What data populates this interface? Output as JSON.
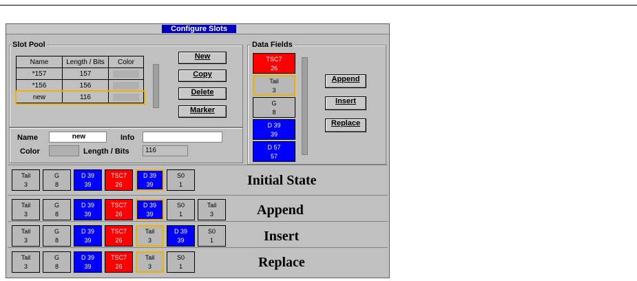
{
  "window": {
    "title": "Configure Slots"
  },
  "slot_pool": {
    "legend": "Slot Pool",
    "columns": [
      "Name",
      "Length / Bits",
      "Color"
    ],
    "rows": [
      {
        "name": "*157",
        "length": "157"
      },
      {
        "name": "*156",
        "length": "156"
      },
      {
        "name": "new",
        "length": "116"
      }
    ],
    "buttons": {
      "new": "New",
      "copy": "Copy",
      "delete": "Delete",
      "marker": "Marker"
    }
  },
  "editor": {
    "name_label": "Name",
    "name_value": "new",
    "info_label": "Info",
    "info_value": "",
    "color_label": "Color",
    "length_label": "Length / Bits",
    "length_value": "116"
  },
  "data_fields": {
    "legend": "Data Fields",
    "items": [
      {
        "top": "TSC7",
        "bottom": "26",
        "color": "red"
      },
      {
        "top": "Tail",
        "bottom": "3",
        "color": "gray",
        "selected": true
      },
      {
        "top": "G",
        "bottom": "8",
        "color": "gray"
      },
      {
        "top": "D 39",
        "bottom": "39",
        "color": "blue"
      },
      {
        "top": "D 57",
        "bottom": "57",
        "color": "blue"
      }
    ],
    "buttons": {
      "append": "Append",
      "insert": "Insert",
      "replace": "Replace"
    }
  },
  "sequences": [
    {
      "label": "Initial State",
      "slots": [
        {
          "top": "Tail",
          "bottom": "3",
          "color": "gray"
        },
        {
          "top": "G",
          "bottom": "8",
          "color": "gray"
        },
        {
          "top": "D 39",
          "bottom": "39",
          "color": "blue"
        },
        {
          "top": "TSC7",
          "bottom": "26",
          "color": "red"
        },
        {
          "top": "D 39",
          "bottom": "39",
          "color": "blue",
          "selected": true
        },
        {
          "top": "S0",
          "bottom": "1",
          "color": "gray"
        }
      ]
    },
    {
      "label": "Append",
      "slots": [
        {
          "top": "Tail",
          "bottom": "3",
          "color": "gray"
        },
        {
          "top": "G",
          "bottom": "8",
          "color": "gray"
        },
        {
          "top": "D 39",
          "bottom": "39",
          "color": "blue"
        },
        {
          "top": "TSC7",
          "bottom": "26",
          "color": "red"
        },
        {
          "top": "D 39",
          "bottom": "39",
          "color": "blue",
          "selected": true
        },
        {
          "top": "S0",
          "bottom": "1",
          "color": "gray"
        },
        {
          "top": "Tail",
          "bottom": "3",
          "color": "gray"
        }
      ]
    },
    {
      "label": "Insert",
      "slots": [
        {
          "top": "Tail",
          "bottom": "3",
          "color": "gray"
        },
        {
          "top": "G",
          "bottom": "8",
          "color": "gray"
        },
        {
          "top": "D 39",
          "bottom": "39",
          "color": "blue"
        },
        {
          "top": "TSC7",
          "bottom": "26",
          "color": "red"
        },
        {
          "top": "Tail",
          "bottom": "3",
          "color": "gray",
          "selected": true
        },
        {
          "top": "D 39",
          "bottom": "39",
          "color": "blue"
        },
        {
          "top": "S0",
          "bottom": "1",
          "color": "gray"
        }
      ]
    },
    {
      "label": "Replace",
      "slots": [
        {
          "top": "Tail",
          "bottom": "3",
          "color": "gray"
        },
        {
          "top": "G",
          "bottom": "8",
          "color": "gray"
        },
        {
          "top": "D 39",
          "bottom": "39",
          "color": "blue"
        },
        {
          "top": "TSC7",
          "bottom": "26",
          "color": "red"
        },
        {
          "top": "Tail",
          "bottom": "3",
          "color": "gray",
          "selected": true
        },
        {
          "top": "S0",
          "bottom": "1",
          "color": "gray"
        }
      ]
    }
  ]
}
